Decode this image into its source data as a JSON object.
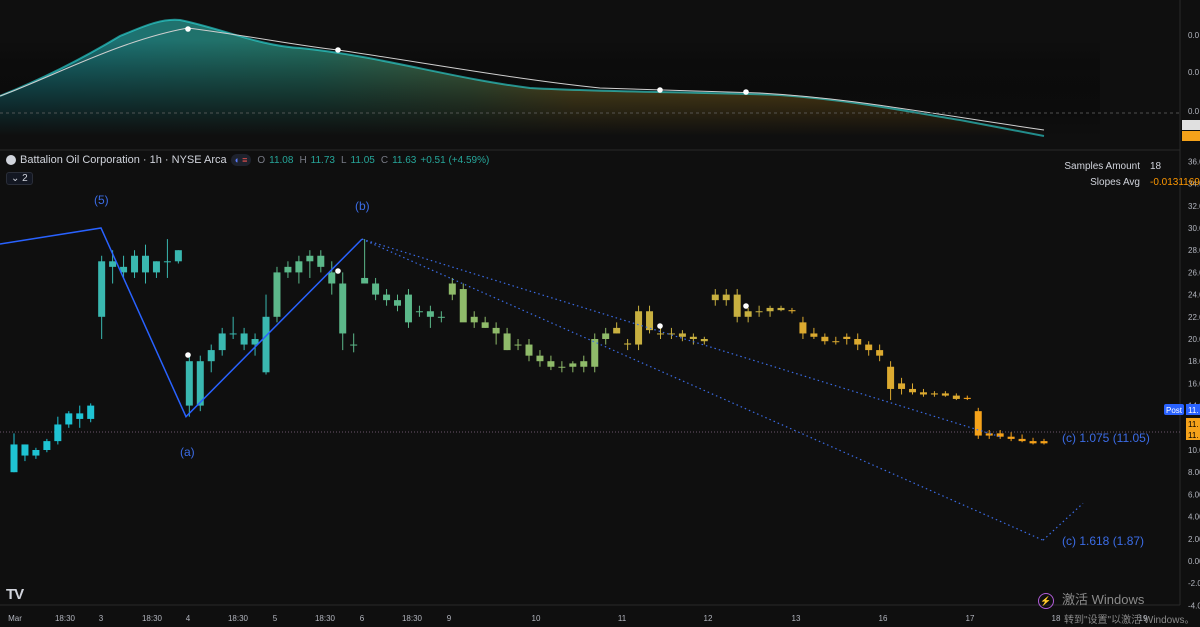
{
  "symbol": {
    "name": "Battalion Oil Corporation · 1h · NYSE Arca",
    "ohlc": {
      "o_label": "O",
      "o": "11.08",
      "h_label": "H",
      "h": "11.73",
      "l_label": "L",
      "l": "11.05",
      "c_label": "C",
      "c": "11.63",
      "change": "+0.51 (+4.59%)"
    },
    "collapse_label": "2"
  },
  "stats": {
    "samples_label": "Samples Amount",
    "samples_value": "18",
    "slopes_label": "Slopes Avg",
    "slopes_value": "-0.013116957"
  },
  "colors": {
    "background": "#0f0f0f",
    "cyan": "#1fc3d3",
    "green": "#5cb88a",
    "yellow": "#c8b040",
    "orange": "#f5a21a",
    "wave": "#2962ff",
    "wave_dotted": "#3b6ce6"
  },
  "wave_labels": [
    {
      "text": "(5)"
    },
    {
      "text": "(a)"
    },
    {
      "text": "(b)"
    },
    {
      "text": "(c) 1.075 (11.05)"
    },
    {
      "text": "(c) 1.618 (1.87)"
    }
  ],
  "price_axis": {
    "main_ticks": [
      "36.00",
      "34.00",
      "32.00",
      "30.00",
      "28.00",
      "26.00",
      "24.00",
      "22.00",
      "20.00",
      "18.00",
      "16.00",
      "14.00",
      "12.00",
      "10.00",
      "8.00",
      "6.00",
      "4.00",
      "2.00",
      "0.00",
      "-2.00",
      "-4.00"
    ],
    "post_label": "Post",
    "post_value": "11.",
    "last_values": [
      "11.",
      "11."
    ],
    "indicator_ticks": [
      "0.0",
      "0.0",
      "0.0",
      "-0.",
      "-0."
    ]
  },
  "time_axis": [
    "Mar",
    "18:30",
    "3",
    "18:30",
    "4",
    "18:30",
    "5",
    "18:30",
    "6",
    "18:30",
    "9",
    "10",
    "11",
    "12",
    "13",
    "16",
    "17",
    "18",
    "19"
  ],
  "watermark": {
    "line1": "激活 Windows",
    "line2": "转到\"设置\"以激活 Windows。"
  },
  "logo": "TV",
  "chart_data": {
    "type": "candlestick",
    "ylim": [
      -4,
      36
    ],
    "candles": [
      [
        8.0,
        11.5,
        8.0,
        10.5
      ],
      [
        10.5,
        10.5,
        9.0,
        9.5
      ],
      [
        9.5,
        10.2,
        9.2,
        10.0
      ],
      [
        10.0,
        11.0,
        9.8,
        10.8
      ],
      [
        10.8,
        13.0,
        10.5,
        12.3
      ],
      [
        12.3,
        13.5,
        12.0,
        13.3
      ],
      [
        13.3,
        14.0,
        12.0,
        12.8
      ],
      [
        12.8,
        14.2,
        12.5,
        14.0
      ],
      [
        22.0,
        27.5,
        20.0,
        27.0
      ],
      [
        27.0,
        28.0,
        25.0,
        26.5
      ],
      [
        26.5,
        27.5,
        25.5,
        26.0
      ],
      [
        26.0,
        28.0,
        25.5,
        27.5
      ],
      [
        27.5,
        28.5,
        25.0,
        26.0
      ],
      [
        26.0,
        27.0,
        25.5,
        27.0
      ],
      [
        27.0,
        29.0,
        25.5,
        27.0
      ],
      [
        27.0,
        28.0,
        26.8,
        28.0
      ],
      [
        14.0,
        18.5,
        13.0,
        18.0
      ],
      [
        14.0,
        18.5,
        13.5,
        18.0
      ],
      [
        18.0,
        19.5,
        17.0,
        19.0
      ],
      [
        19.0,
        21.0,
        18.5,
        20.5
      ],
      [
        20.5,
        22.0,
        20.0,
        20.5
      ],
      [
        20.5,
        21.0,
        19.0,
        19.5
      ],
      [
        19.5,
        20.5,
        18.5,
        20.0
      ],
      [
        17.0,
        24.0,
        16.8,
        22.0
      ],
      [
        22.0,
        26.5,
        21.5,
        26.0
      ],
      [
        26.0,
        27.0,
        25.5,
        26.5
      ],
      [
        26.0,
        27.5,
        25.0,
        27.0
      ],
      [
        27.0,
        28.0,
        25.5,
        27.5
      ],
      [
        26.5,
        28.0,
        26.0,
        27.5
      ],
      [
        26.0,
        27.0,
        24.0,
        25.0
      ],
      [
        25.0,
        26.0,
        19.0,
        20.5
      ],
      [
        19.5,
        20.5,
        18.8,
        19.5
      ],
      [
        25.5,
        29.0,
        25.0,
        25.0
      ],
      [
        25.0,
        25.5,
        23.5,
        24.0
      ],
      [
        24.0,
        24.5,
        23.0,
        23.5
      ],
      [
        23.5,
        24.0,
        22.5,
        23.0
      ],
      [
        24.0,
        24.5,
        21.0,
        21.5
      ],
      [
        22.5,
        23.0,
        22.0,
        22.5
      ],
      [
        22.5,
        23.0,
        21.0,
        22.0
      ],
      [
        22.0,
        22.5,
        21.5,
        22.0
      ],
      [
        25.0,
        25.5,
        23.5,
        24.0
      ],
      [
        24.5,
        25.0,
        22.0,
        21.5
      ],
      [
        22.0,
        22.5,
        21.0,
        21.5
      ],
      [
        21.5,
        22.0,
        21.0,
        21.0
      ],
      [
        21.0,
        21.5,
        19.5,
        20.5
      ],
      [
        20.5,
        21.0,
        19.0,
        19.0
      ],
      [
        19.5,
        20.0,
        19.0,
        19.5
      ],
      [
        19.5,
        20.0,
        18.0,
        18.5
      ],
      [
        18.5,
        19.0,
        17.5,
        18.0
      ],
      [
        18.0,
        18.5,
        17.2,
        17.5
      ],
      [
        17.5,
        18.0,
        17.0,
        17.5
      ],
      [
        17.5,
        18.0,
        17.0,
        17.8
      ],
      [
        18.0,
        18.5,
        17.0,
        17.5
      ],
      [
        17.5,
        20.5,
        17.0,
        20.0
      ],
      [
        20.0,
        21.0,
        19.5,
        20.5
      ],
      [
        20.5,
        21.5,
        20.5,
        21.0
      ],
      [
        19.5,
        20.0,
        19.0,
        19.6
      ],
      [
        19.5,
        23.0,
        19.0,
        22.5
      ],
      [
        22.5,
        23.0,
        20.5,
        20.8
      ],
      [
        20.5,
        21.0,
        20.0,
        20.5
      ],
      [
        20.5,
        21.0,
        20.0,
        20.5
      ],
      [
        20.5,
        20.8,
        19.8,
        20.2
      ],
      [
        20.2,
        20.5,
        19.5,
        20.0
      ],
      [
        20.0,
        20.2,
        19.5,
        19.8
      ],
      [
        23.5,
        24.5,
        23.0,
        24.0
      ],
      [
        24.0,
        24.5,
        23.0,
        23.5
      ],
      [
        24.0,
        24.5,
        21.5,
        22.0
      ],
      [
        22.0,
        22.8,
        21.5,
        22.5
      ],
      [
        22.5,
        23.0,
        22.0,
        22.5
      ],
      [
        22.5,
        23.0,
        22.0,
        22.8
      ],
      [
        22.8,
        23.0,
        22.5,
        22.6
      ],
      [
        22.6,
        22.8,
        22.3,
        22.5
      ],
      [
        21.5,
        22.0,
        20.0,
        20.5
      ],
      [
        20.5,
        21.0,
        20.0,
        20.2
      ],
      [
        20.2,
        20.5,
        19.5,
        19.8
      ],
      [
        19.8,
        20.2,
        19.5,
        19.8
      ],
      [
        20.0,
        20.5,
        19.5,
        20.2
      ],
      [
        20.0,
        20.5,
        19.0,
        19.5
      ],
      [
        19.5,
        19.8,
        18.5,
        19.0
      ],
      [
        19.0,
        19.5,
        18.0,
        18.5
      ],
      [
        17.5,
        18.0,
        14.5,
        15.5
      ],
      [
        15.5,
        16.5,
        15.0,
        16.0
      ],
      [
        15.5,
        16.0,
        15.0,
        15.2
      ],
      [
        15.2,
        15.5,
        14.8,
        15.0
      ],
      [
        15.0,
        15.3,
        14.8,
        15.1
      ],
      [
        15.1,
        15.3,
        14.8,
        14.9
      ],
      [
        14.9,
        15.1,
        14.5,
        14.6
      ],
      [
        14.6,
        14.9,
        14.5,
        14.7
      ],
      [
        13.5,
        13.8,
        11.0,
        11.3
      ],
      [
        11.3,
        11.8,
        11.0,
        11.5
      ],
      [
        11.5,
        11.8,
        11.0,
        11.2
      ],
      [
        11.2,
        11.6,
        10.8,
        11.0
      ],
      [
        11.0,
        11.4,
        10.7,
        10.8
      ],
      [
        10.8,
        11.1,
        10.5,
        10.6
      ],
      [
        10.6,
        11.0,
        10.5,
        10.8
      ]
    ],
    "wave_points": [
      [
        29,
        5
      ],
      [
        101,
        30
      ],
      [
        186,
        13
      ],
      [
        362,
        29
      ],
      [
        1043,
        1.87
      ]
    ]
  }
}
